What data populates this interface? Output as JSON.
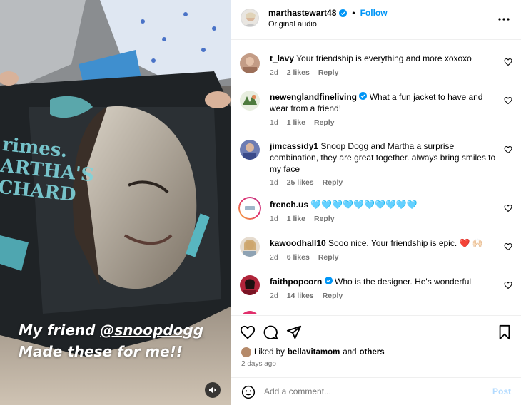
{
  "media": {
    "caption_line1_prefix": "My friend ",
    "caption_mention": "@snoopdogg",
    "caption_line2": "Made these for me!!",
    "jacket_text": "rimes. ARTHA'S CHARD",
    "mute_icon": "speaker-muted-icon"
  },
  "header": {
    "username": "marthastewart48",
    "separator": "•",
    "follow_label": "Follow",
    "audio": "Original audio",
    "more_label": "•••"
  },
  "comments": [
    {
      "user": "t_lavy",
      "verified": false,
      "text": "Your friendship is everything and more xoxoxo",
      "age": "2d",
      "likes": "2 likes",
      "reply": "Reply"
    },
    {
      "user": "newenglandfineliving",
      "verified": true,
      "text": "What a fun jacket to have and wear from a friend!",
      "age": "1d",
      "likes": "1 like",
      "reply": "Reply"
    },
    {
      "user": "jimcassidy1",
      "verified": false,
      "text": "Snoop Dogg and Martha a surprise combination, they are great together. always bring smiles to my face",
      "age": "1d",
      "likes": "25 likes",
      "reply": "Reply"
    },
    {
      "user": "french.us",
      "verified": false,
      "text": "🩵🩵🩵🩵🩵🩵🩵🩵🩵🩵",
      "age": "1d",
      "likes": "1 like",
      "reply": "Reply"
    },
    {
      "user": "kawoodhall10",
      "verified": false,
      "text": "Sooo nice. Your friendship is epic. ❤️ 🙌🏻",
      "age": "2d",
      "likes": "6 likes",
      "reply": "Reply"
    },
    {
      "user": "faithpopcorn",
      "verified": true,
      "text": "Who is the designer. He's wonderful",
      "age": "2d",
      "likes": "14 likes",
      "reply": "Reply"
    }
  ],
  "actions": {
    "liked_prefix": "Liked by",
    "liked_user": "bellavitamom",
    "liked_and": "and",
    "liked_others": "others",
    "time_ago": "2 days ago"
  },
  "add_comment": {
    "placeholder": "Add a comment...",
    "post_label": "Post"
  },
  "colors": {
    "accent": "#0095f6",
    "muted_text": "#737373",
    "post_disabled": "#b3dbff"
  }
}
